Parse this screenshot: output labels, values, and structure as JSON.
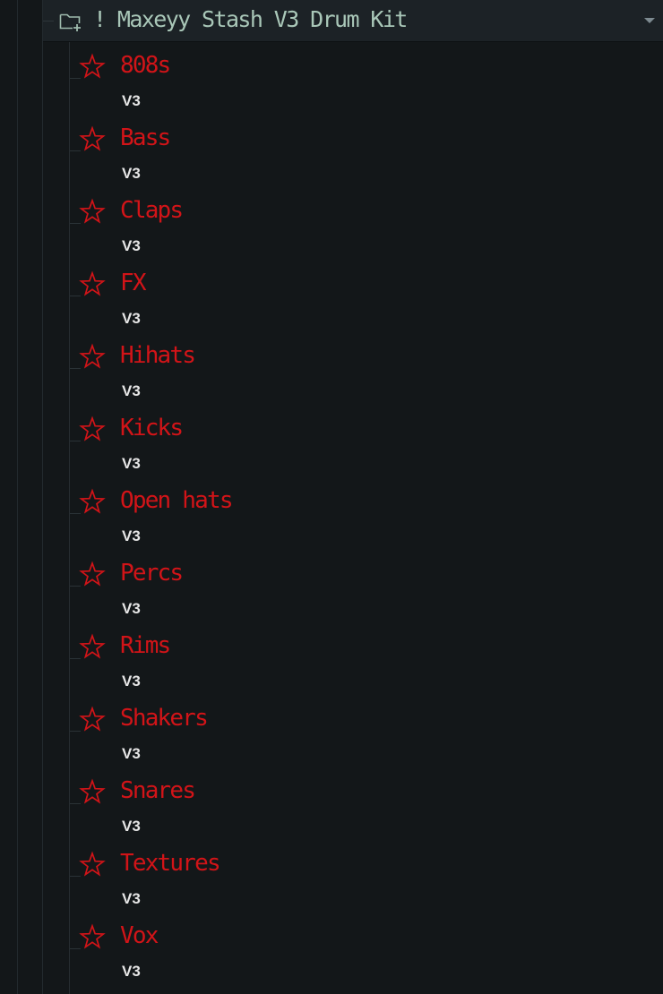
{
  "header": {
    "title": "! Maxeyy Stash V3 Drum Kit",
    "icon": "folder-add-icon",
    "dropdown_icon": "caret-down-icon"
  },
  "colors": {
    "background": "#131719",
    "header_background": "#1c2226",
    "header_text": "#a9c7b8",
    "item_text": "#d21418",
    "star": "#d21418",
    "subtitle_text": "#e6e6e6"
  },
  "items": [
    {
      "name": "808s",
      "sub": "V3",
      "icon": "star-outline-icon"
    },
    {
      "name": "Bass",
      "sub": "V3",
      "icon": "star-outline-icon"
    },
    {
      "name": "Claps",
      "sub": "V3",
      "icon": "star-outline-icon"
    },
    {
      "name": "FX",
      "sub": "V3",
      "icon": "star-outline-icon"
    },
    {
      "name": "Hihats",
      "sub": "V3",
      "icon": "star-outline-icon"
    },
    {
      "name": "Kicks",
      "sub": "V3",
      "icon": "star-outline-icon"
    },
    {
      "name": "Open hats",
      "sub": "V3",
      "icon": "star-outline-icon"
    },
    {
      "name": "Percs",
      "sub": "V3",
      "icon": "star-outline-icon"
    },
    {
      "name": "Rims",
      "sub": "V3",
      "icon": "star-outline-icon"
    },
    {
      "name": "Shakers",
      "sub": "V3",
      "icon": "star-outline-icon"
    },
    {
      "name": "Snares",
      "sub": "V3",
      "icon": "star-outline-icon"
    },
    {
      "name": "Textures",
      "sub": "V3",
      "icon": "star-outline-icon"
    },
    {
      "name": "Vox",
      "sub": "V3",
      "icon": "star-outline-icon"
    }
  ]
}
